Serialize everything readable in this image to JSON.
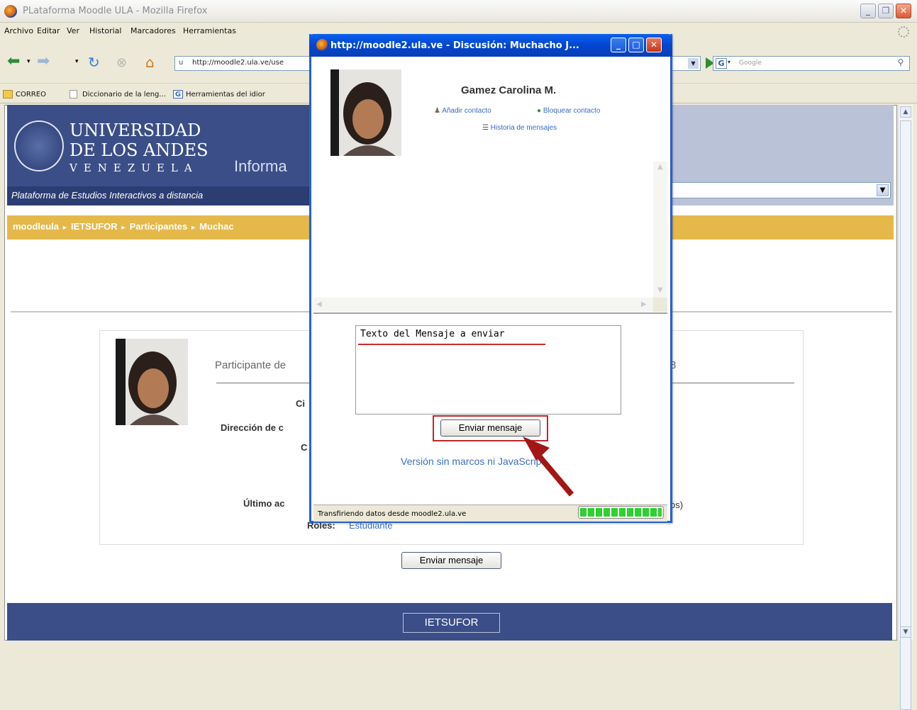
{
  "browser": {
    "title": "PLataforma Moodle ULA - Mozilla Firefox",
    "menu": [
      "Archivo",
      "Editar",
      "Ver",
      "Historial",
      "Marcadores",
      "Herramientas"
    ],
    "url": "http://moodle2.ula.ve/use",
    "search_placeholder": "Google",
    "bookmarks": [
      "CORREO",
      "Diccionario de la leng...",
      "Herramientas del idior"
    ]
  },
  "page": {
    "uni_line1": "UNIVERSIDAD",
    "uni_line2": "DE LOS ANDES",
    "uni_line3": "VENEZUELA",
    "banner_tail": "Informa",
    "platform": "Plataforma de Estudios Interactivos a distancia",
    "breadcrumbs": [
      "moodleula",
      "IETSUFOR",
      "Participantes",
      "Muchac"
    ],
    "participant_label": "Participante de",
    "participant_tail": "8",
    "field_ci": "Ci",
    "field_dir": "Dirección de c",
    "field_c": "C",
    "field_last": "Último ac",
    "field_last_tail": "os)",
    "roles_label": "Roles:",
    "roles_value": "Estudiante",
    "send_button": "Enviar mensaje",
    "footer_button": "IETSUFOR"
  },
  "popup": {
    "title": "http://moodle2.ula.ve - Discusión: Muchacho J...",
    "name": "Gamez Carolina M.",
    "add_contact": "Añadir contacto",
    "block_contact": "Bloquear contacto",
    "history": "Historia de mensajes",
    "message_text": "Texto del Mensaje a enviar",
    "send_button": "Enviar mensaje",
    "nojs_link": "Versión sin marcos ni JavaScript",
    "status": "Transfiriendo datos desde moodle2.ula.ve",
    "progress": 1.0
  },
  "colors": {
    "accent_red": "#c0262a",
    "breadcrumb_bar": "#e5b84a",
    "header_blue": "#3b4e88",
    "link_blue": "#3b6fc4"
  }
}
